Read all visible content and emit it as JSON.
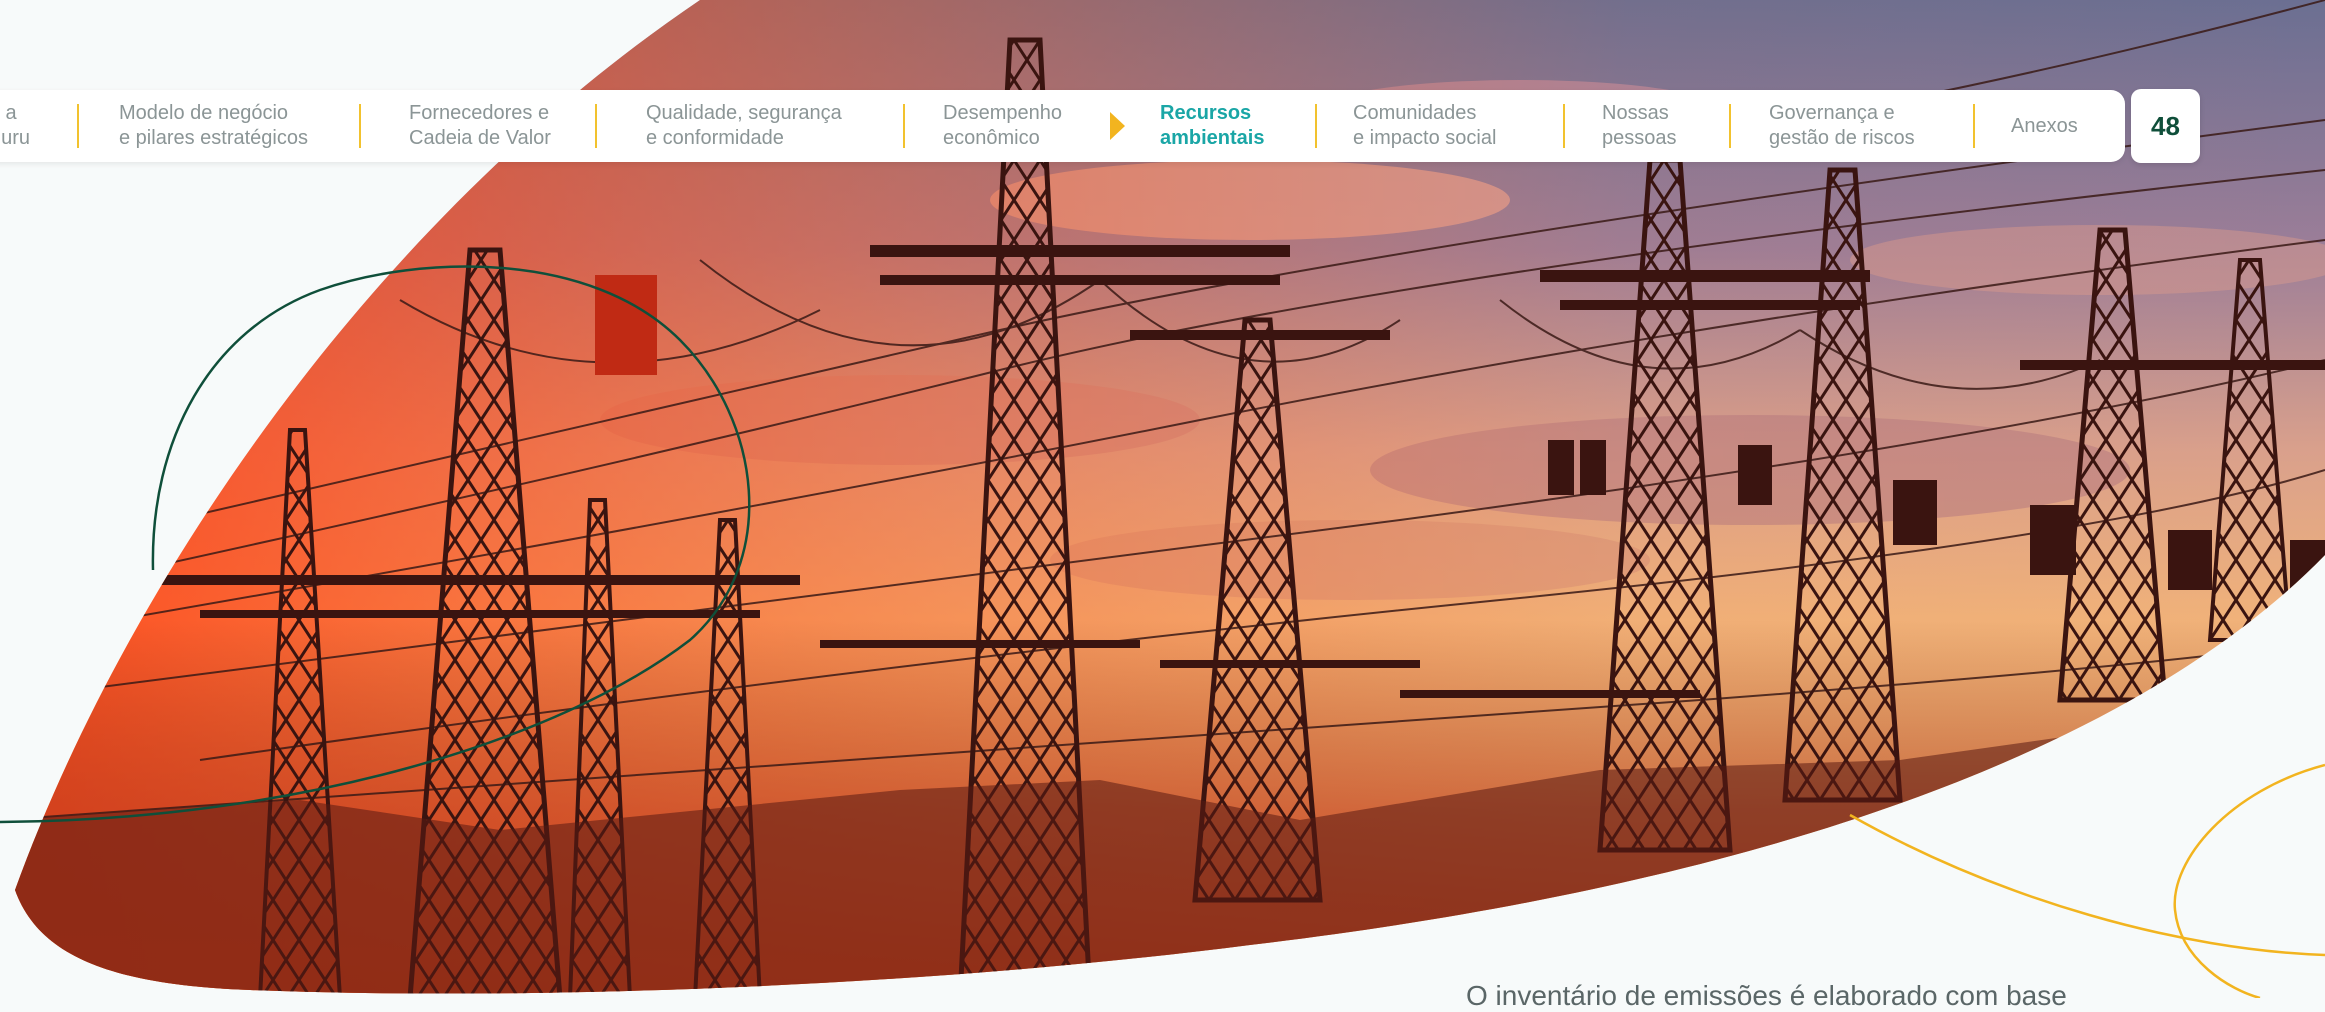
{
  "nav": {
    "items": [
      {
        "line1": "s a",
        "line2": "nuru",
        "active": false
      },
      {
        "line1": "Modelo de negócio",
        "line2": "e pilares estratégicos",
        "active": false
      },
      {
        "line1": "Fornecedores e",
        "line2": "Cadeia de Valor",
        "active": false
      },
      {
        "line1": "Qualidade, segurança",
        "line2": "e conformidade",
        "active": false
      },
      {
        "line1": "Desempenho",
        "line2": "econômico",
        "active": false
      },
      {
        "line1": "Recursos",
        "line2": "ambientais",
        "active": true
      },
      {
        "line1": "Comunidades",
        "line2": "e impacto social",
        "active": false
      },
      {
        "line1": "Nossas",
        "line2": "pessoas",
        "active": false
      },
      {
        "line1": "Governança e",
        "line2": "gestão de riscos",
        "active": false
      },
      {
        "line1": "Anexos",
        "line2": "",
        "active": false
      }
    ]
  },
  "page_number": "48",
  "body_text": "O inventário de emissões é elaborado com base",
  "colors": {
    "active_text": "#1aa6a6",
    "inactive_text": "#8b9596",
    "separator": "#f2c22e",
    "accent_line_green": "#0f4f3a",
    "accent_line_yellow": "#f2b41f",
    "page_number": "#0f4f3a"
  }
}
